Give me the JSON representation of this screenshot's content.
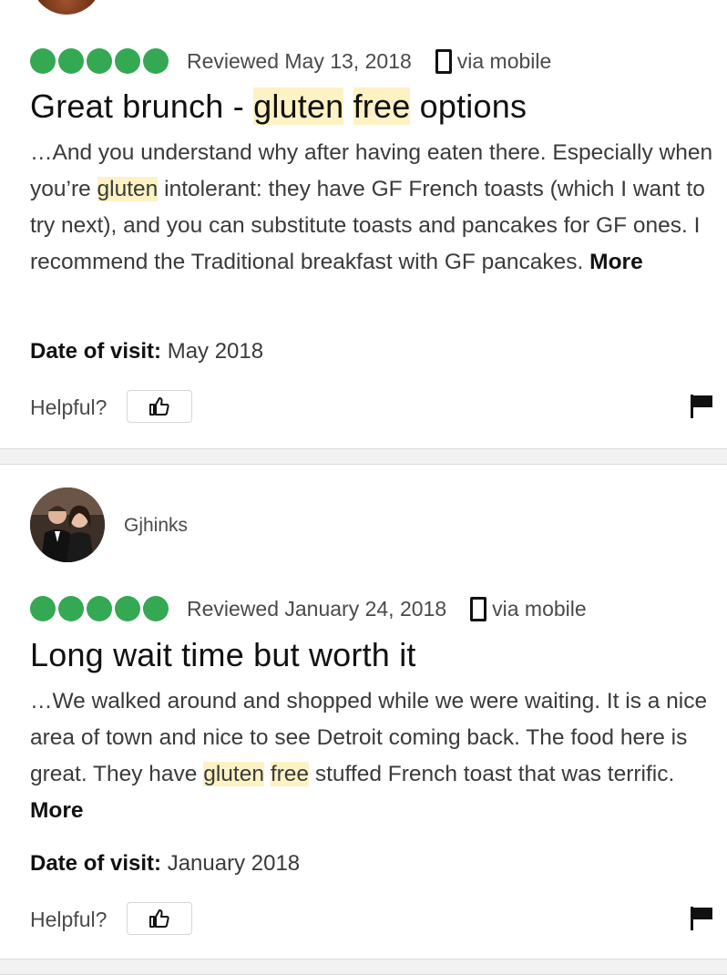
{
  "reviews": [
    {
      "rating_bubbles": 5,
      "reviewed": "Reviewed May 13, 2018",
      "via": "via mobile",
      "title": {
        "t1": "Great brunch - ",
        "h1": "gluten",
        "h2": "free",
        "t2": " options"
      },
      "body": {
        "p1": "…And you understand why after having eaten there. Especially when you’re ",
        "h1": "gluten",
        "p2": " intolerant: they have GF French toasts (which I want to try next), and you can substitute toasts and pancakes for GF ones. I recommend the Traditional breakfast with GF pancakes. "
      },
      "more": "More",
      "date_label": "Date of visit:",
      "date_value": " May 2018",
      "helpful": "Helpful?"
    },
    {
      "username": "Gjhinks",
      "rating_bubbles": 5,
      "reviewed": "Reviewed January 24, 2018",
      "via": "via mobile",
      "title": "Long wait time but worth it",
      "body": {
        "p1": "…We walked around and shopped while we were waiting. It is a nice area of town and nice to see Detroit coming back. The food here is great. They have ",
        "h1": "gluten",
        "h2": "free",
        "p2": " stuffed French toast that was terrific. "
      },
      "more": "More",
      "date_label": "Date of visit:",
      "date_value": " January 2018",
      "helpful": "Helpful?"
    }
  ],
  "colors": {
    "rating_bubble": "#34a853",
    "highlight": "#fdf2c4"
  },
  "icons": [
    "phone-icon",
    "thumbs-up-icon",
    "flag-icon"
  ]
}
